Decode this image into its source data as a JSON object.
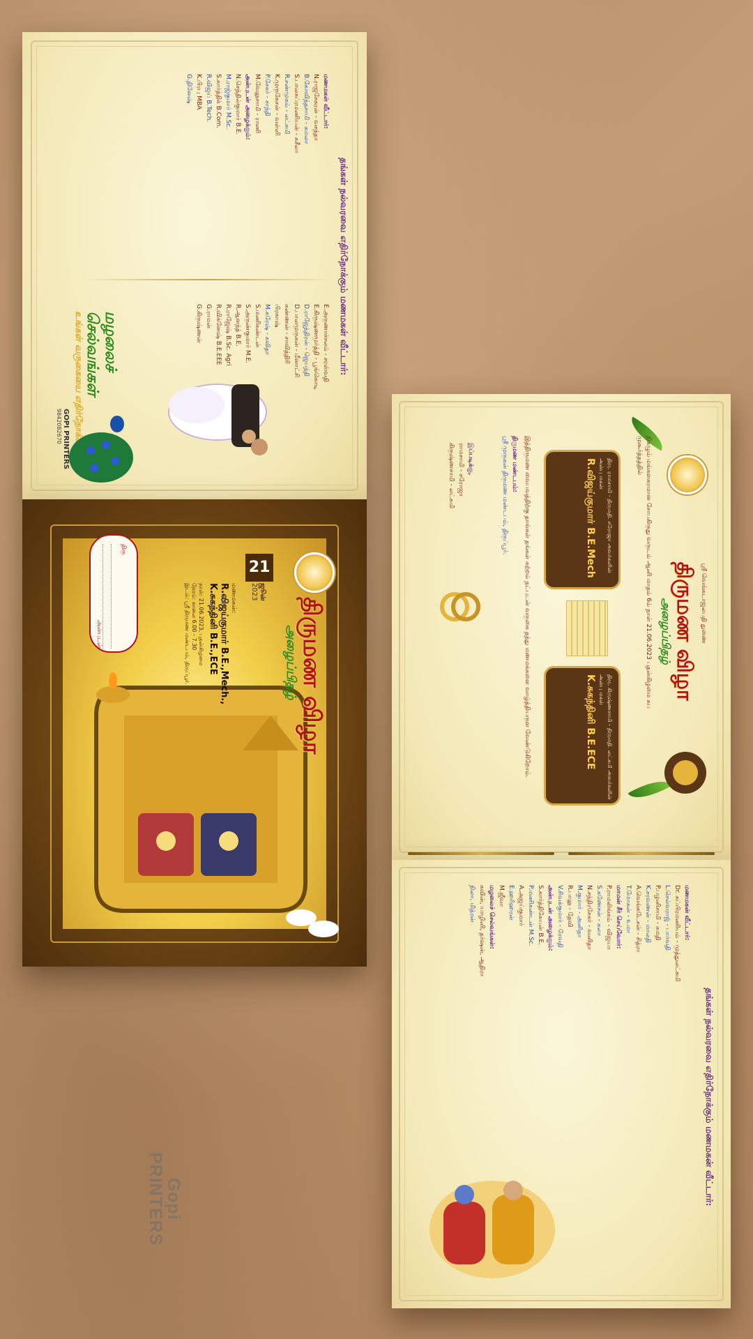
{
  "watermark": {
    "line1": "Gopi",
    "line2": "PRINTERS"
  },
  "card1": {
    "heading": "தங்கள் நல்வரவை எதிர்நோக்கும் மணமகள் வீட்டார்:",
    "col1_title": "மணமகள் வீட்டார்:",
    "col1_lines": [
      "N.ராஜசேகரன் - வசந்தா",
      "B.கோவிந்தசாமி - கமலா",
      "S.பாலசுப்ரமணியன் - சுசீலா",
      "R.சண்முகம் - லட்சுமி",
      "K.முருகேசன் - வள்ளி",
      "P.சேகர் - சாந்தி",
      "M.வேலுசாமி - ராணி"
    ],
    "col1_title2": "அன்புடன் அழைக்கும்:",
    "col1_lines2": [
      "N.செந்தில்குமார் B.E.",
      "M.ராஜ்குமார் M.Sc.",
      "S.கார்த்திக் B.Com.",
      "R.விஜய் B.Tech.",
      "K.பிரபு MBA",
      "G.தினேஷ்"
    ],
    "col2_lines": [
      "E.அருணாச்சலம் - சரஸ்வதி",
      "E.கிருஷ்ணமூர்த்தி - பூங்கொடி",
      "D.ராஜேந்திரன் - ஜெயந்தி",
      "D.பாலமுருகன் - மீனாட்சி",
      "கண்ணன் - சாவித்திரி",
      "பிரகாஷ்",
      "M.சுரேஷ் - கவிதா",
      "S.மணிகண்டன்",
      "S.அருண்குமார் M.E.",
      "R.ஆனந்த் B.E.",
      "R.ராஜேஷ் B.Sc. Agri",
      "R.விக்னேஷ் B.E.EEE",
      "G.ராமன்",
      "G.கிருஷ்ணன்"
    ],
    "card_title": "மழலைச் செல்வங்கள்",
    "card_subtitle": "உங்கள் வருகையை எதிர்நோக்கி",
    "printer_name": "GOPI PRINTERS",
    "printer_phone": "9842082670"
  },
  "card2": {
    "title": "திருமண விழா",
    "subtitle": "அழைப்பிதழ்",
    "day": "21",
    "month": "ஜூன்",
    "year": "2023",
    "lbl_groom_side": "மணமகன்:",
    "groom": "R.விஜய்குமார் B.E.,Mech.,",
    "bride": "K.சுகந்தினி B.E.,ECE",
    "date_line": "நாள்: 21.06.2023, புதன்கிழமை",
    "time_line": "நேரம்: காலை 6.00 - 7.30",
    "venue_line": "இடம்: ஸ்ரீ திருமண மண்டபம், திருப்பூர்.",
    "to_label": "திரு",
    "from_label": "அன்புடன்"
  },
  "card3": {
    "title": "திருமண விழா",
    "subtitle": "அழைப்பிதழ்",
    "invocation": "ஸ்ரீ வெங்கடாஜலபதி துணை",
    "intro": "நிகழும் மங்களகரமான சோபகிருது வருடம் ஆனி மாதம் 6ம் நாள் 21.06.2023 புதன்கிழமை சுப முகூர்த்தத்தில்",
    "groom": "R.விஜய்குமார் B.E.Mech",
    "groom_desc": "திரு. ராமசாமி - திருமதி. சரோஜா அவர்களின் அன்பு மகன்",
    "bride": "K.சுகந்தினி B.E.ECE",
    "bride_desc": "திரு. கிருஷ்ணசாமி - திருமதி. லட்சுமி அவர்களின் அன்பு மகள்",
    "invite_text": "இத்திருமண வைபவத்திற்கு தாங்கள் தங்கள் சுற்றம் நட்புடன் வருகை தந்து மணமக்களை வாழ்த்தியருள வேண்டுகிறோம்.",
    "venue_label": "திருமண மண்டபம்:",
    "venue": "ஸ்ரீ முருகன் திருமண மண்டபம், திருப்பூர்.",
    "sign_label": "இப்படிக்கு,",
    "signers": [
      "ராமசாமி - சரோஜா",
      "கிருஷ்ணசாமி - லட்சுமி"
    ]
  },
  "card4": {
    "heading": "தங்கள் நல்வரவை எதிர்நோக்கும் மணமகன் வீட்டார்:",
    "title1": "மணமகன் வீட்டார்:",
    "lines1": [
      "Dr. சுப்பிரமணியம் - முத்துலட்சுமி",
      "L.செல்வராஜ் - பார்வதி",
      "P.பழனிசாமி - சுமதி",
      "K.சரவணன் - மாலதி",
      "A.வெங்கடேசன் - சித்ரா",
      "T.மோகன் - உமா"
    ],
    "title2": "மாமன் சீர் செய்வோர்:",
    "lines2": [
      "P.ராமலிங்கம் - விஜயா",
      "S.கணேசன் - கலா",
      "N.சந்திரசேகர் - வனிதா",
      "M.குமார் - அனிதா",
      "R.பாலு - தேவி",
      "V.சிவக்குமார் - ரேவதி"
    ],
    "title3": "அன்புடன் அழைக்கும்:",
    "lines3": [
      "S.கார்த்திகேயன் B.E.",
      "P.மணிகண்டன் M.Sc.",
      "A.அஜய்குமார்",
      "E.ஹரிஹரன்",
      "M.ஜீவா"
    ],
    "title4": "மழலைச் செல்வங்கள்:",
    "lines4": [
      "கவின், யாழினி, தர்ஷன், ஆதிரா",
      "நிலா, மித்ரன்"
    ]
  }
}
